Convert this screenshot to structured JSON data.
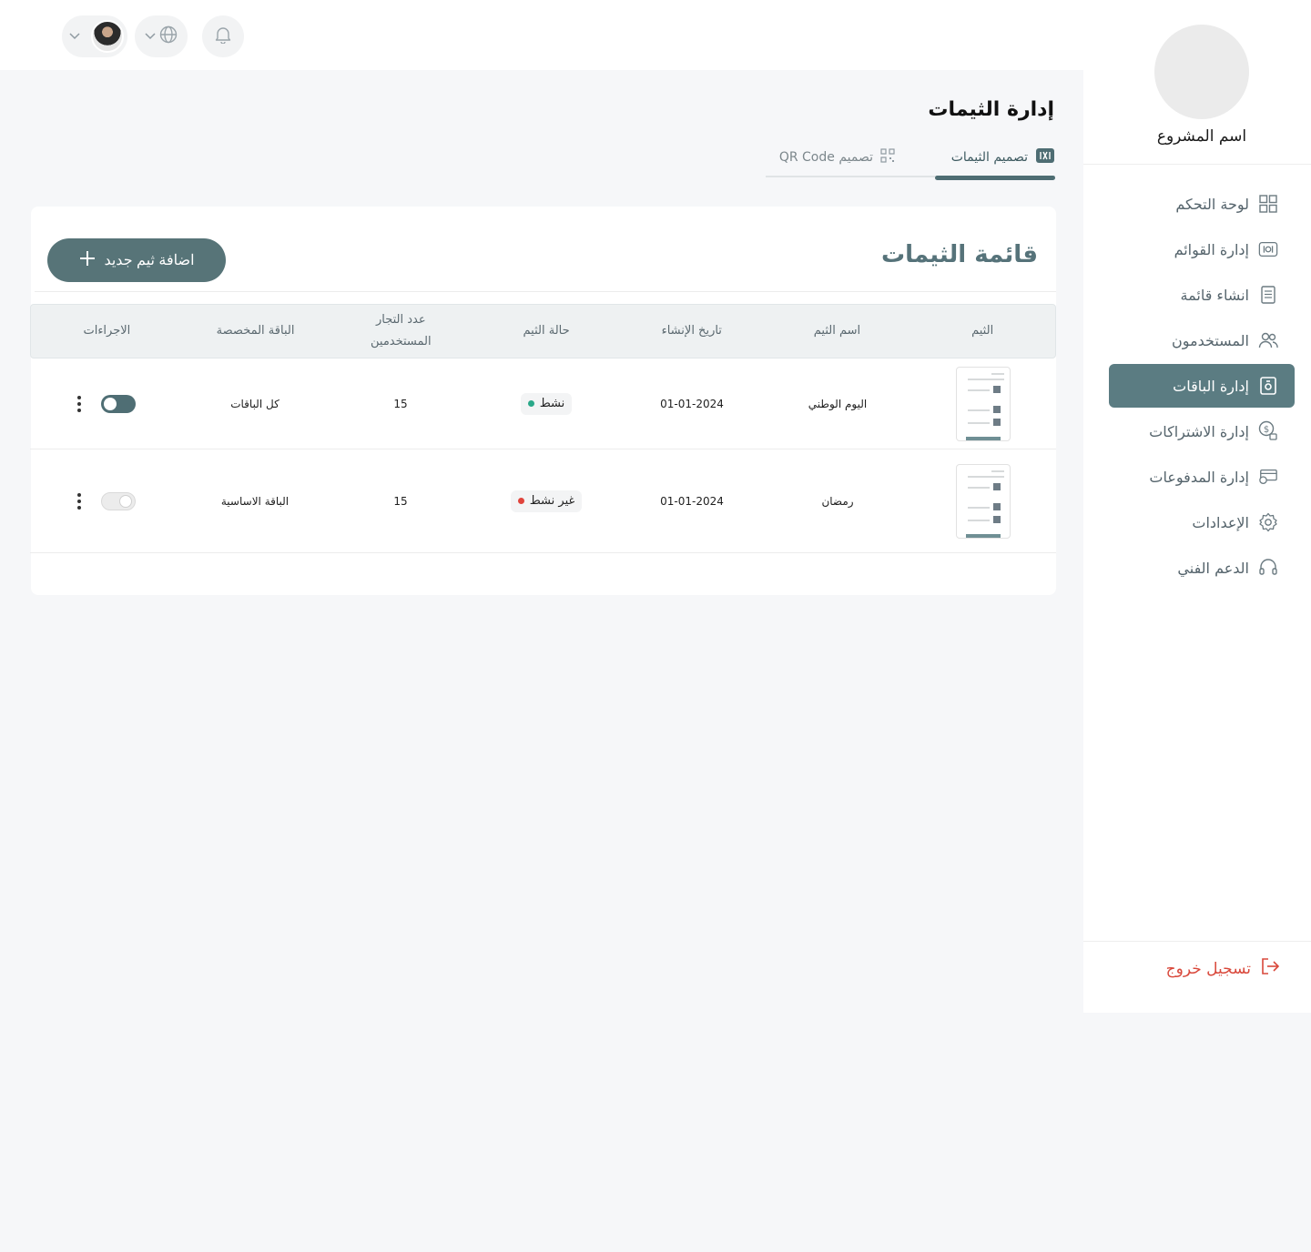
{
  "header": {
    "bell_icon": "bell-icon",
    "language_icon": "globe-icon"
  },
  "sidebar": {
    "project_name": "اسم المشروع",
    "items": [
      {
        "label": "لوحة التحكم",
        "icon": "dashboard-grid-icon",
        "active": false
      },
      {
        "label": "إدارة القوائم",
        "icon": "menu-card-icon",
        "active": false
      },
      {
        "label": "انشاء قائمة",
        "icon": "document-list-icon",
        "active": false
      },
      {
        "label": "المستخدمون",
        "icon": "users-icon",
        "active": false
      },
      {
        "label": "إدارة الباقات",
        "icon": "package-icon",
        "active": true
      },
      {
        "label": "إدارة الاشتراكات",
        "icon": "subscription-icon",
        "active": false
      },
      {
        "label": "إدارة المدفوعات",
        "icon": "payments-icon",
        "active": false
      },
      {
        "label": "الإعدادات",
        "icon": "settings-gear-icon",
        "active": false
      },
      {
        "label": "الدعم الفني",
        "icon": "headset-icon",
        "active": false
      }
    ],
    "logout_label": "تسجيل خروج"
  },
  "page": {
    "title": "إدارة الثيمات",
    "tabs": [
      {
        "label": "تصميم الثيمات",
        "active": true
      },
      {
        "label": "تصميم QR Code",
        "active": false
      }
    ]
  },
  "card": {
    "title": "قائمة الثيمات",
    "add_button_label": "اضافة ثيم جديد"
  },
  "table": {
    "headers": [
      "الثيم",
      "اسم الثيم",
      "تاريخ الإنشاء",
      "حالة الثيم",
      "عدد التجار المستخدمين",
      "الباقة المخصصة",
      "الاجراءات"
    ],
    "rows": [
      {
        "name": "اليوم الوطني",
        "created": "01-01-2024",
        "status": "نشط",
        "status_color": "#2aa889",
        "merchants": "15",
        "package": "كل الباقات",
        "enabled": true
      },
      {
        "name": "رمضان",
        "created": "01-01-2024",
        "status": "غير نشط",
        "status_color": "#e0443c",
        "merchants": "15",
        "package": "الباقة الاساسية",
        "enabled": false
      }
    ]
  },
  "colors": {
    "primary": "#577478",
    "logout": "#d9483b"
  }
}
